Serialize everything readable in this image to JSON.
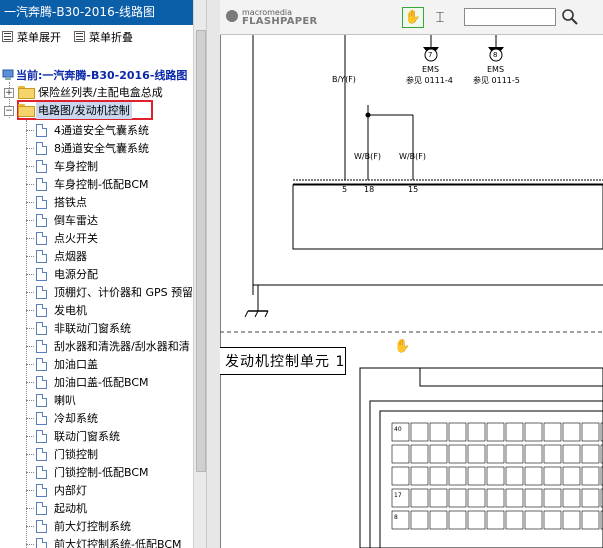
{
  "window": {
    "title": "一汽奔腾-B30-2016-线路图"
  },
  "menu": {
    "expand_label": "菜单展开",
    "collapse_label": "菜单折叠"
  },
  "tree": {
    "root_label": "当前:一汽奔腾-B30-2016-线路图",
    "folders": [
      {
        "label": "保险丝列表/主配电盒总成",
        "state": "collapsed"
      },
      {
        "label": "电路图/发动机控制",
        "state": "expanded",
        "selected": true
      }
    ],
    "items": [
      "4通道安全气囊系统",
      "8通道安全气囊系统",
      "车身控制",
      "车身控制-低配BCM",
      "搭铁点",
      "倒车雷达",
      "点火开关",
      "点烟器",
      "电源分配",
      "顶棚灯、计价器和 GPS 预留",
      "发电机",
      "非联动门窗系统",
      "刮水器和清洗器/刮水器和清",
      "加油口盖",
      "加油口盖-低配BCM",
      "喇叭",
      "冷却系统",
      "联动门窗系统",
      "门锁控制",
      "门锁控制-低配BCM",
      "内部灯",
      "起动机",
      "前大灯控制系统",
      "前大灯控制系统-低配BCM"
    ]
  },
  "viewer": {
    "logo_top": "macromedia",
    "logo_bottom": "FLASHPAPER",
    "search_value": "",
    "hand_tool_icon": "hand-icon",
    "select_tool_icon": "text-cursor-icon",
    "search_icon": "magnifier-icon"
  },
  "diagram": {
    "connectors": [
      {
        "number": "7",
        "module": "EMS",
        "ref": "参见 0111-4"
      },
      {
        "number": "8",
        "module": "EMS",
        "ref": "参见 0111-5"
      }
    ],
    "wires": [
      {
        "color_code": "B/Y(F)"
      },
      {
        "color_code": "W/B(F)"
      },
      {
        "color_code": "W/B(F)"
      }
    ],
    "pins": [
      "5",
      "18",
      "15"
    ],
    "ecu_title": "发动机控制单元 1",
    "pin_grid": [
      [
        "40",
        "",
        "",
        "",
        "",
        "",
        "",
        "",
        "",
        "",
        "",
        ""
      ],
      [
        "",
        "",
        "",
        "",
        "",
        "",
        "",
        "",
        "",
        "",
        "",
        ""
      ],
      [
        "",
        "",
        "",
        "",
        "",
        "",
        "",
        "",
        "",
        "",
        "",
        ""
      ],
      [
        "17",
        "",
        "",
        "",
        "",
        "",
        "",
        "",
        "",
        "",
        "",
        ""
      ],
      [
        "8",
        "",
        "",
        "",
        "",
        "",
        "",
        "",
        "",
        "",
        "",
        ""
      ]
    ]
  }
}
